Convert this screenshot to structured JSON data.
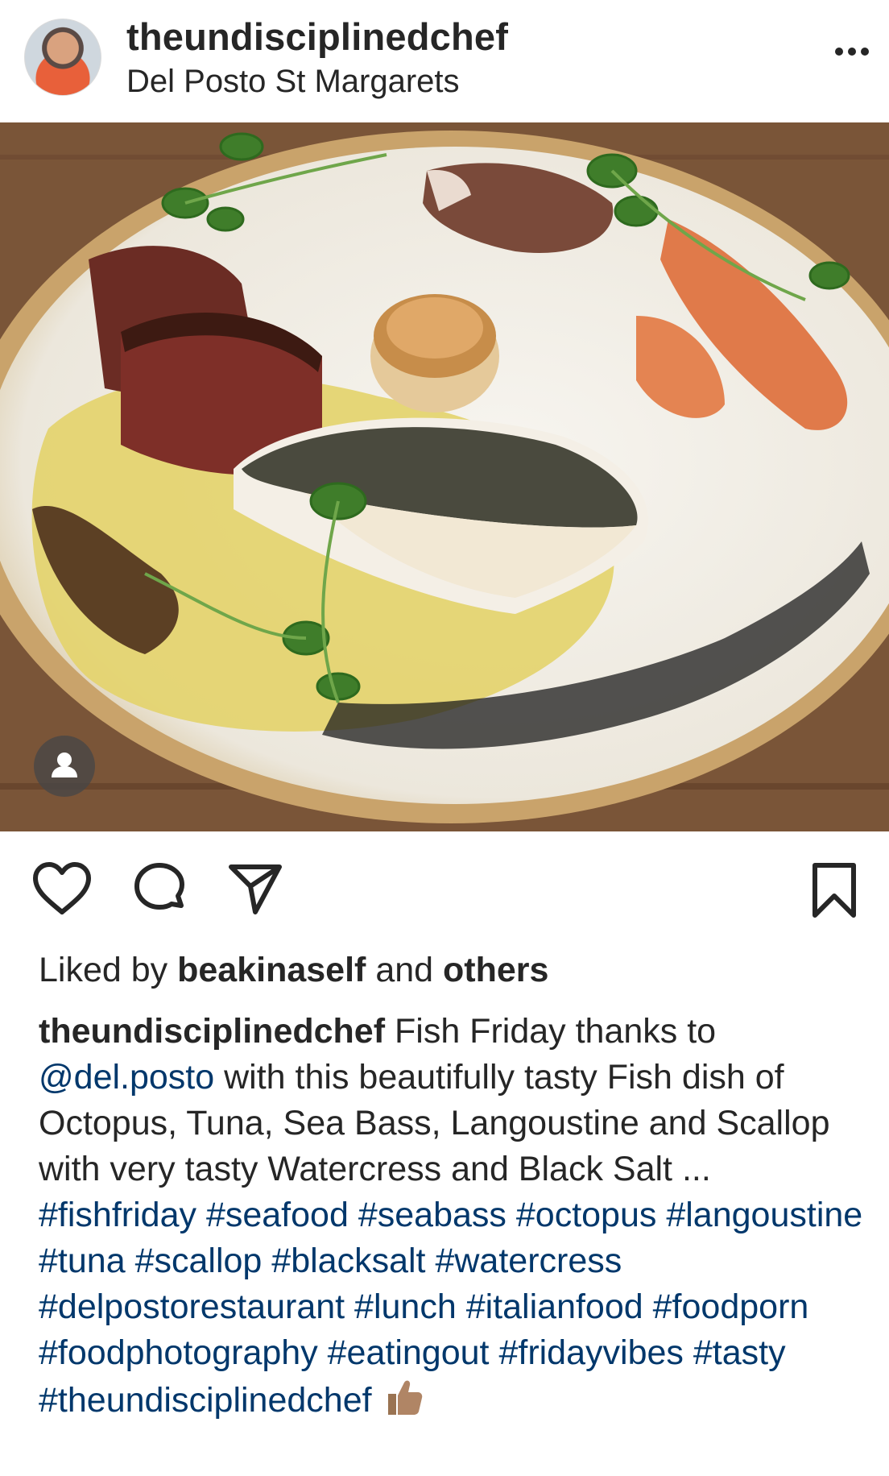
{
  "post": {
    "username": "theundisciplinedchef",
    "location": "Del Posto St Margarets",
    "avatar_icon": "profile-avatar",
    "more_icon": "more-options-icon"
  },
  "actions": {
    "like_icon": "heart-icon",
    "comment_icon": "comment-icon",
    "share_icon": "send-icon",
    "save_icon": "bookmark-icon",
    "tag_icon": "user-tag-icon"
  },
  "likes": {
    "prefix": "Liked by",
    "user": "beakinaself",
    "conjunction": "and",
    "others": "others"
  },
  "caption": {
    "author": "theundisciplinedchef",
    "text_1": "Fish Friday thanks to",
    "mention": "@del.posto",
    "text_2": "with this beautifully tasty Fish dish of Octopus, Tuna, Sea Bass, Langoustine and Scallop with very tasty Watercress and Black Salt ...",
    "hashtags": [
      "#fishfriday",
      "#seafood",
      "#seabass",
      "#octopus",
      "#langoustine",
      "#tuna",
      "#scallop",
      "#blacksalt",
      "#watercress",
      "#delpostorestaurant",
      "#lunch",
      "#italianfood",
      "#foodporn",
      "#foodphotography",
      "#eatingout",
      "#fridayvibes",
      "#tasty",
      "#theundisciplinedchef"
    ],
    "emoji_icon": "thumbs-up-emoji"
  },
  "colors": {
    "text": "#262626",
    "link": "#00376b",
    "background": "#ffffff"
  }
}
